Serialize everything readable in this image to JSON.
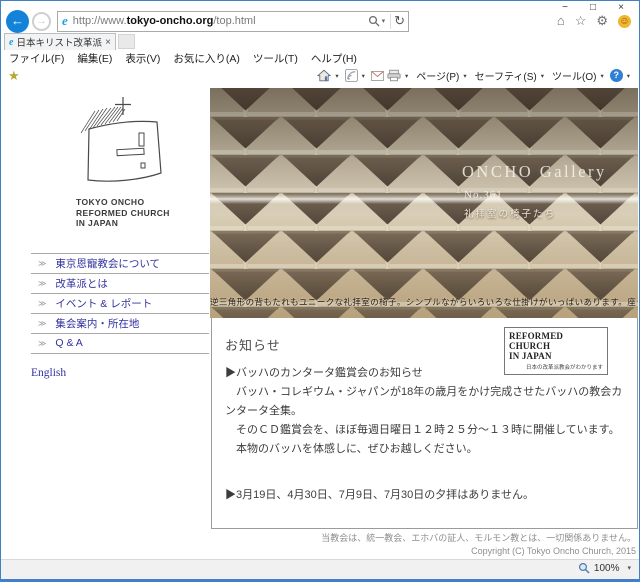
{
  "window_controls": {
    "minimize": "−",
    "maximize": "□",
    "close": "×"
  },
  "browser": {
    "url": {
      "prefix": "http://www.",
      "domain": "tokyo-oncho.org",
      "path": "/top.html"
    },
    "tab": {
      "title": "日本キリスト改革派東京恩寵...",
      "close": "×"
    },
    "menus": [
      "ファイル(F)",
      "編集(E)",
      "表示(V)",
      "お気に入り(A)",
      "ツール(T)",
      "ヘルプ(H)"
    ],
    "command_bar": {
      "page": "ページ(P)",
      "safety": "セーフティ(S)",
      "tools": "ツール(O)",
      "help": "?"
    },
    "status": {
      "zoom": "100%"
    }
  },
  "icons": {
    "back": "←",
    "forward": "→",
    "dropdown": "▾",
    "refresh": "↻",
    "home": "⌂",
    "favorites_star": "☆",
    "gear": "⚙",
    "smiley": "☺",
    "command_star": "★",
    "nav_bullet": "≫",
    "favicon": "e"
  },
  "sidebar": {
    "logo": {
      "line1": "TOKYO ONCHO",
      "line2": "REFORMED CHURCH",
      "line3": "IN JAPAN"
    },
    "nav": [
      "東京恩寵教会について",
      "改革派とは",
      "イベント & レポート",
      "集会案内・所在地",
      "Q & A"
    ],
    "english": "English"
  },
  "hero": {
    "title": "ONCHO Gallery",
    "number": "No.361",
    "subtitle": "礼拝室の椅子たち",
    "caption": "逆三角形の背もたれもユニークな礼拝室の椅子。シンプルながらいろいろな仕掛けがいっぱいあります。座ってみたらわかります。"
  },
  "news": {
    "heading": "お知らせ",
    "badge": {
      "line1": "REFORMED CHURCH",
      "line2": "IN JAPAN",
      "small": "日本の改革派教会がわかります"
    },
    "item1": {
      "line1": "▶バッハのカンタータ鑑賞会のお知らせ",
      "line2": "　バッハ・コレギウム・ジャパンが18年の歳月をかけ完成させたバッハの教会カンタータ全集。",
      "line3": "　そのＣＤ鑑賞会を、ほぼ毎週日曜日１２時２５分～１３時に開催しています。",
      "line4": "　本物のバッハを体感しに、ぜひお越しください。"
    },
    "item2": "▶3月19日、4月30日、7月9日、7月30日の夕拝はありません。"
  },
  "footer": {
    "disclaimer": "当教会は、統一教会、エホバの証人、モルモン教とは、一切関係ありません。",
    "copyright": "Copyright (C) Tokyo Oncho Church, 2015"
  },
  "colors": {
    "accent_blue": "#1283d8",
    "link_blue": "#32329f",
    "window_border": "#4180c4"
  }
}
